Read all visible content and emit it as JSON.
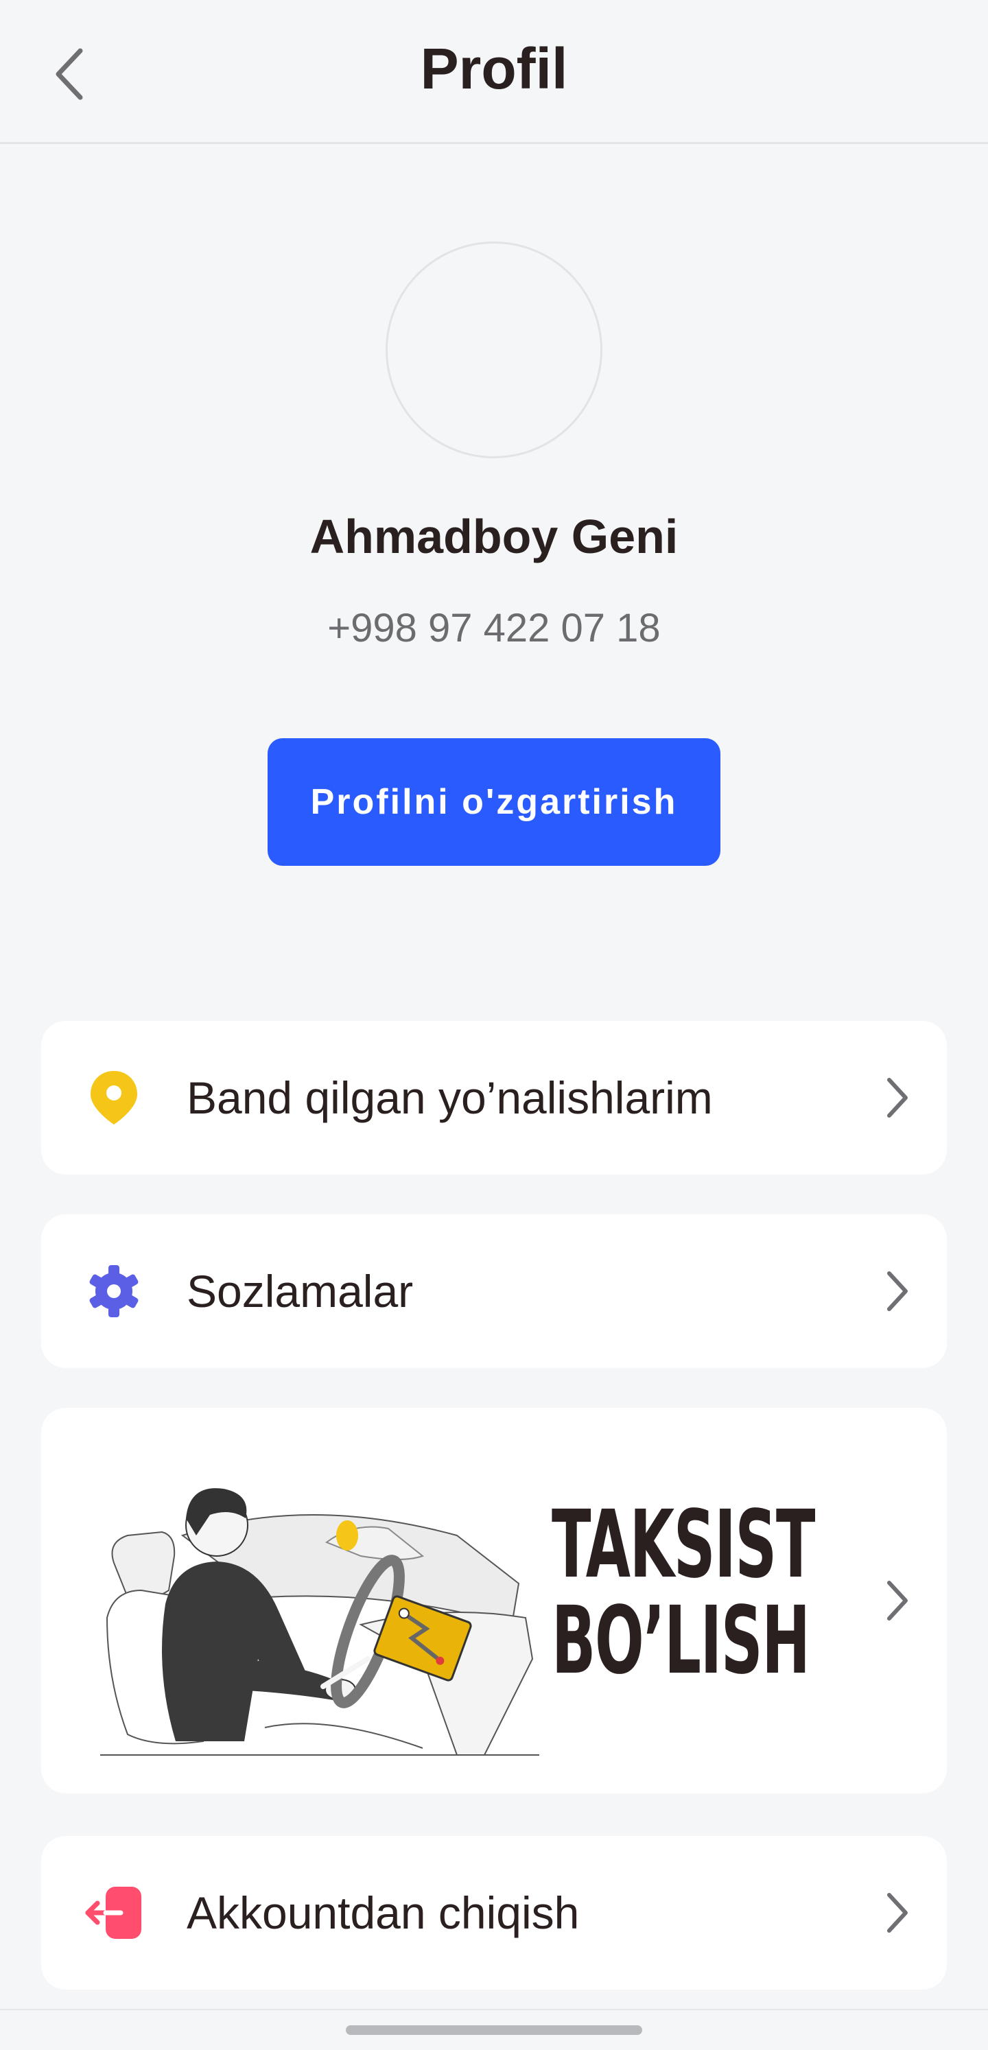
{
  "header": {
    "title": "Profil",
    "back_icon": "chevron-left-icon"
  },
  "profile": {
    "name": "Ahmadboy Geni",
    "phone": "+998 97 422 07 18",
    "edit_button_label": "Profilni o'zgartirish"
  },
  "menu": {
    "items": [
      {
        "label": "Band qilgan yo’nalishlarim",
        "icon": "location-pin-icon",
        "icon_color": "#f5c518"
      },
      {
        "label": "Sozlamalar",
        "icon": "gear-icon",
        "icon_color": "#5a5fe6"
      },
      {
        "label": "Akkountdan chiqish",
        "icon": "logout-icon",
        "icon_color": "#ff4d6d"
      }
    ]
  },
  "banner": {
    "title_line1": "TAKSIST",
    "title_line2": "BO’LISH",
    "illustration": "taxi-driver-illustration"
  },
  "colors": {
    "accent": "#2a5bff",
    "background": "#f5f6f8",
    "card": "#ffffff",
    "text": "#2a201f",
    "muted": "#6b6b70"
  }
}
